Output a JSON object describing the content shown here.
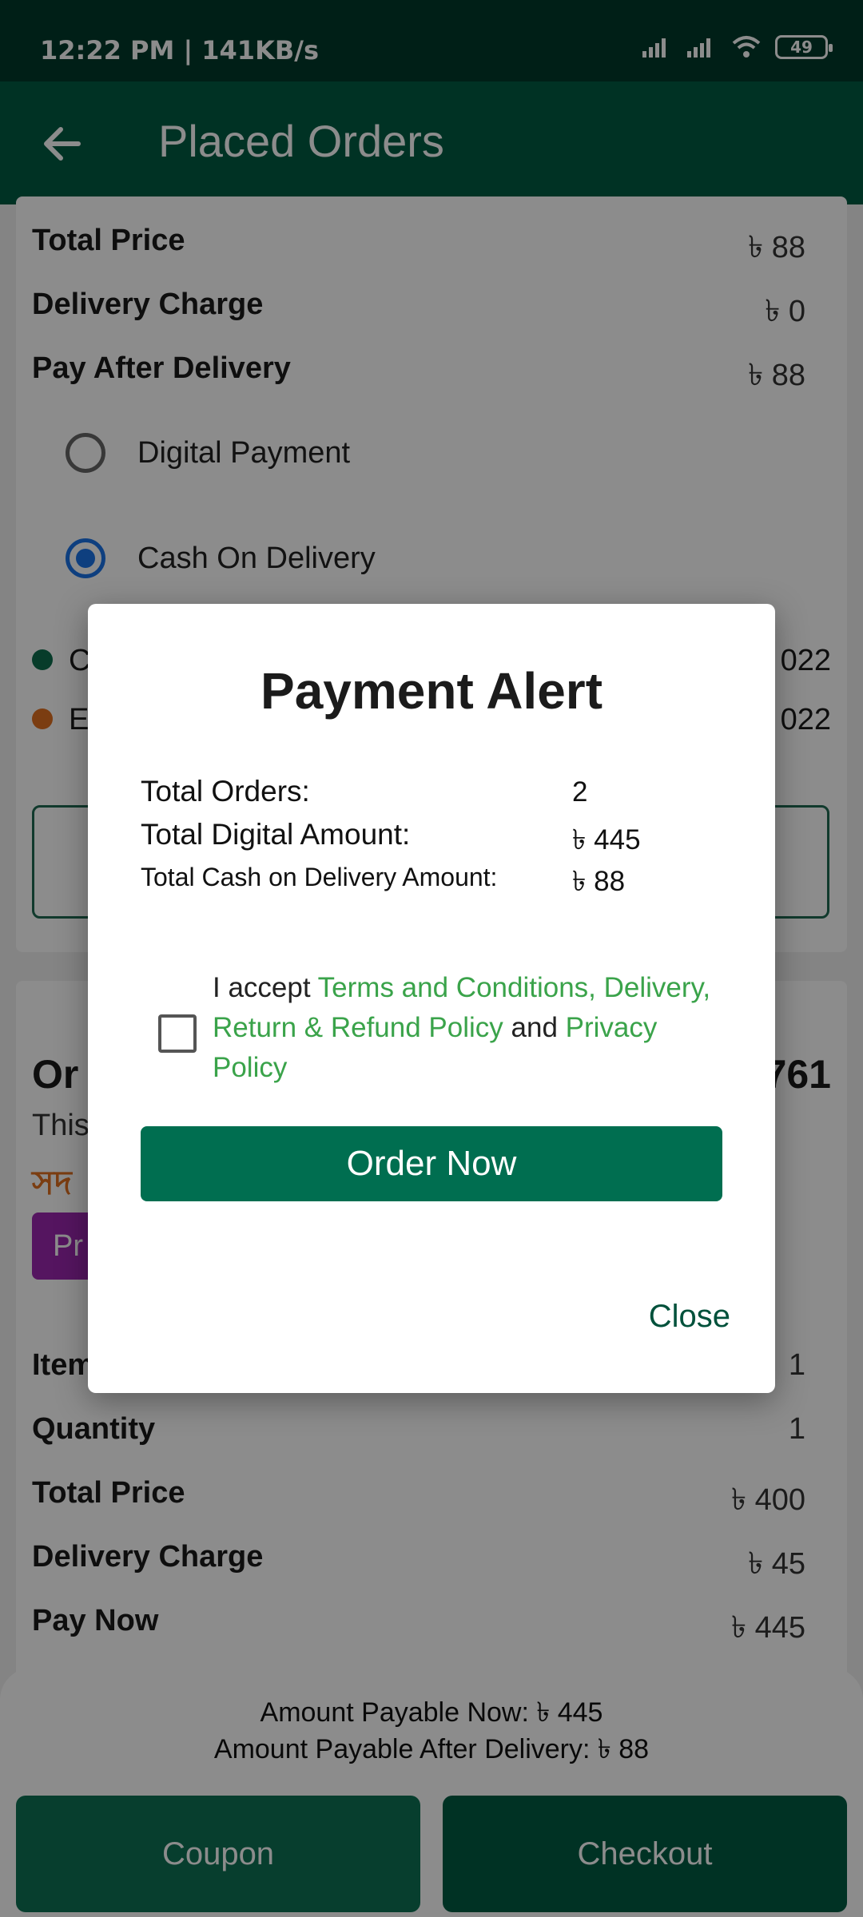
{
  "status_bar": {
    "time": "12:22 PM | 141KB/s",
    "battery": "49"
  },
  "app_bar": {
    "title": "Placed Orders"
  },
  "order1": {
    "rows": [
      {
        "label": "Total Price",
        "value": "৳ 88"
      },
      {
        "label": "Delivery Charge",
        "value": "৳ 0"
      },
      {
        "label": "Pay After Delivery",
        "value": "৳ 88"
      }
    ],
    "payment_options": [
      {
        "label": "Digital Payment",
        "selected": false
      },
      {
        "label": "Cash On Delivery",
        "selected": true
      }
    ],
    "status_lines": [
      {
        "left": "C",
        "right": "022",
        "color": "#0e6e4e"
      },
      {
        "left": "E",
        "right": "022",
        "color": "#e07020"
      }
    ]
  },
  "order2": {
    "head_left": "Or",
    "head_right": "761",
    "this_text": "This",
    "bn_text": "সদ",
    "badge": "Pr",
    "rows": [
      {
        "label": "Items",
        "value": "1"
      },
      {
        "label": "Quantity",
        "value": "1"
      },
      {
        "label": "Total Price",
        "value": "৳ 400"
      },
      {
        "label": "Delivery Charge",
        "value": "৳ 45"
      },
      {
        "label": "Pay Now",
        "value": "৳ 445"
      }
    ]
  },
  "bottom": {
    "payable_now": "Amount Payable Now: ৳ 445",
    "payable_after": "Amount Payable After Delivery: ৳ 88",
    "coupon_label": "Coupon",
    "checkout_label": "Checkout"
  },
  "dialog": {
    "title": "Payment Alert",
    "total_orders_label": "Total Orders:",
    "total_orders_value": "2",
    "digital_label": "Total Digital Amount:",
    "digital_value": "৳ 445",
    "cod_label": "Total Cash on Delivery Amount:",
    "cod_value": "৳ 88",
    "terms_prefix": "I accept ",
    "terms_link1": "Terms and Conditions, Delivery, Return & Refund Policy",
    "terms_and": " and ",
    "terms_link2": "Privacy Policy",
    "order_now": "Order Now",
    "close": "Close"
  },
  "colors": {
    "primary": "#005b43",
    "status_bar": "#013a2b",
    "link": "#3aa34a",
    "radio_selected": "#1a73e8"
  }
}
